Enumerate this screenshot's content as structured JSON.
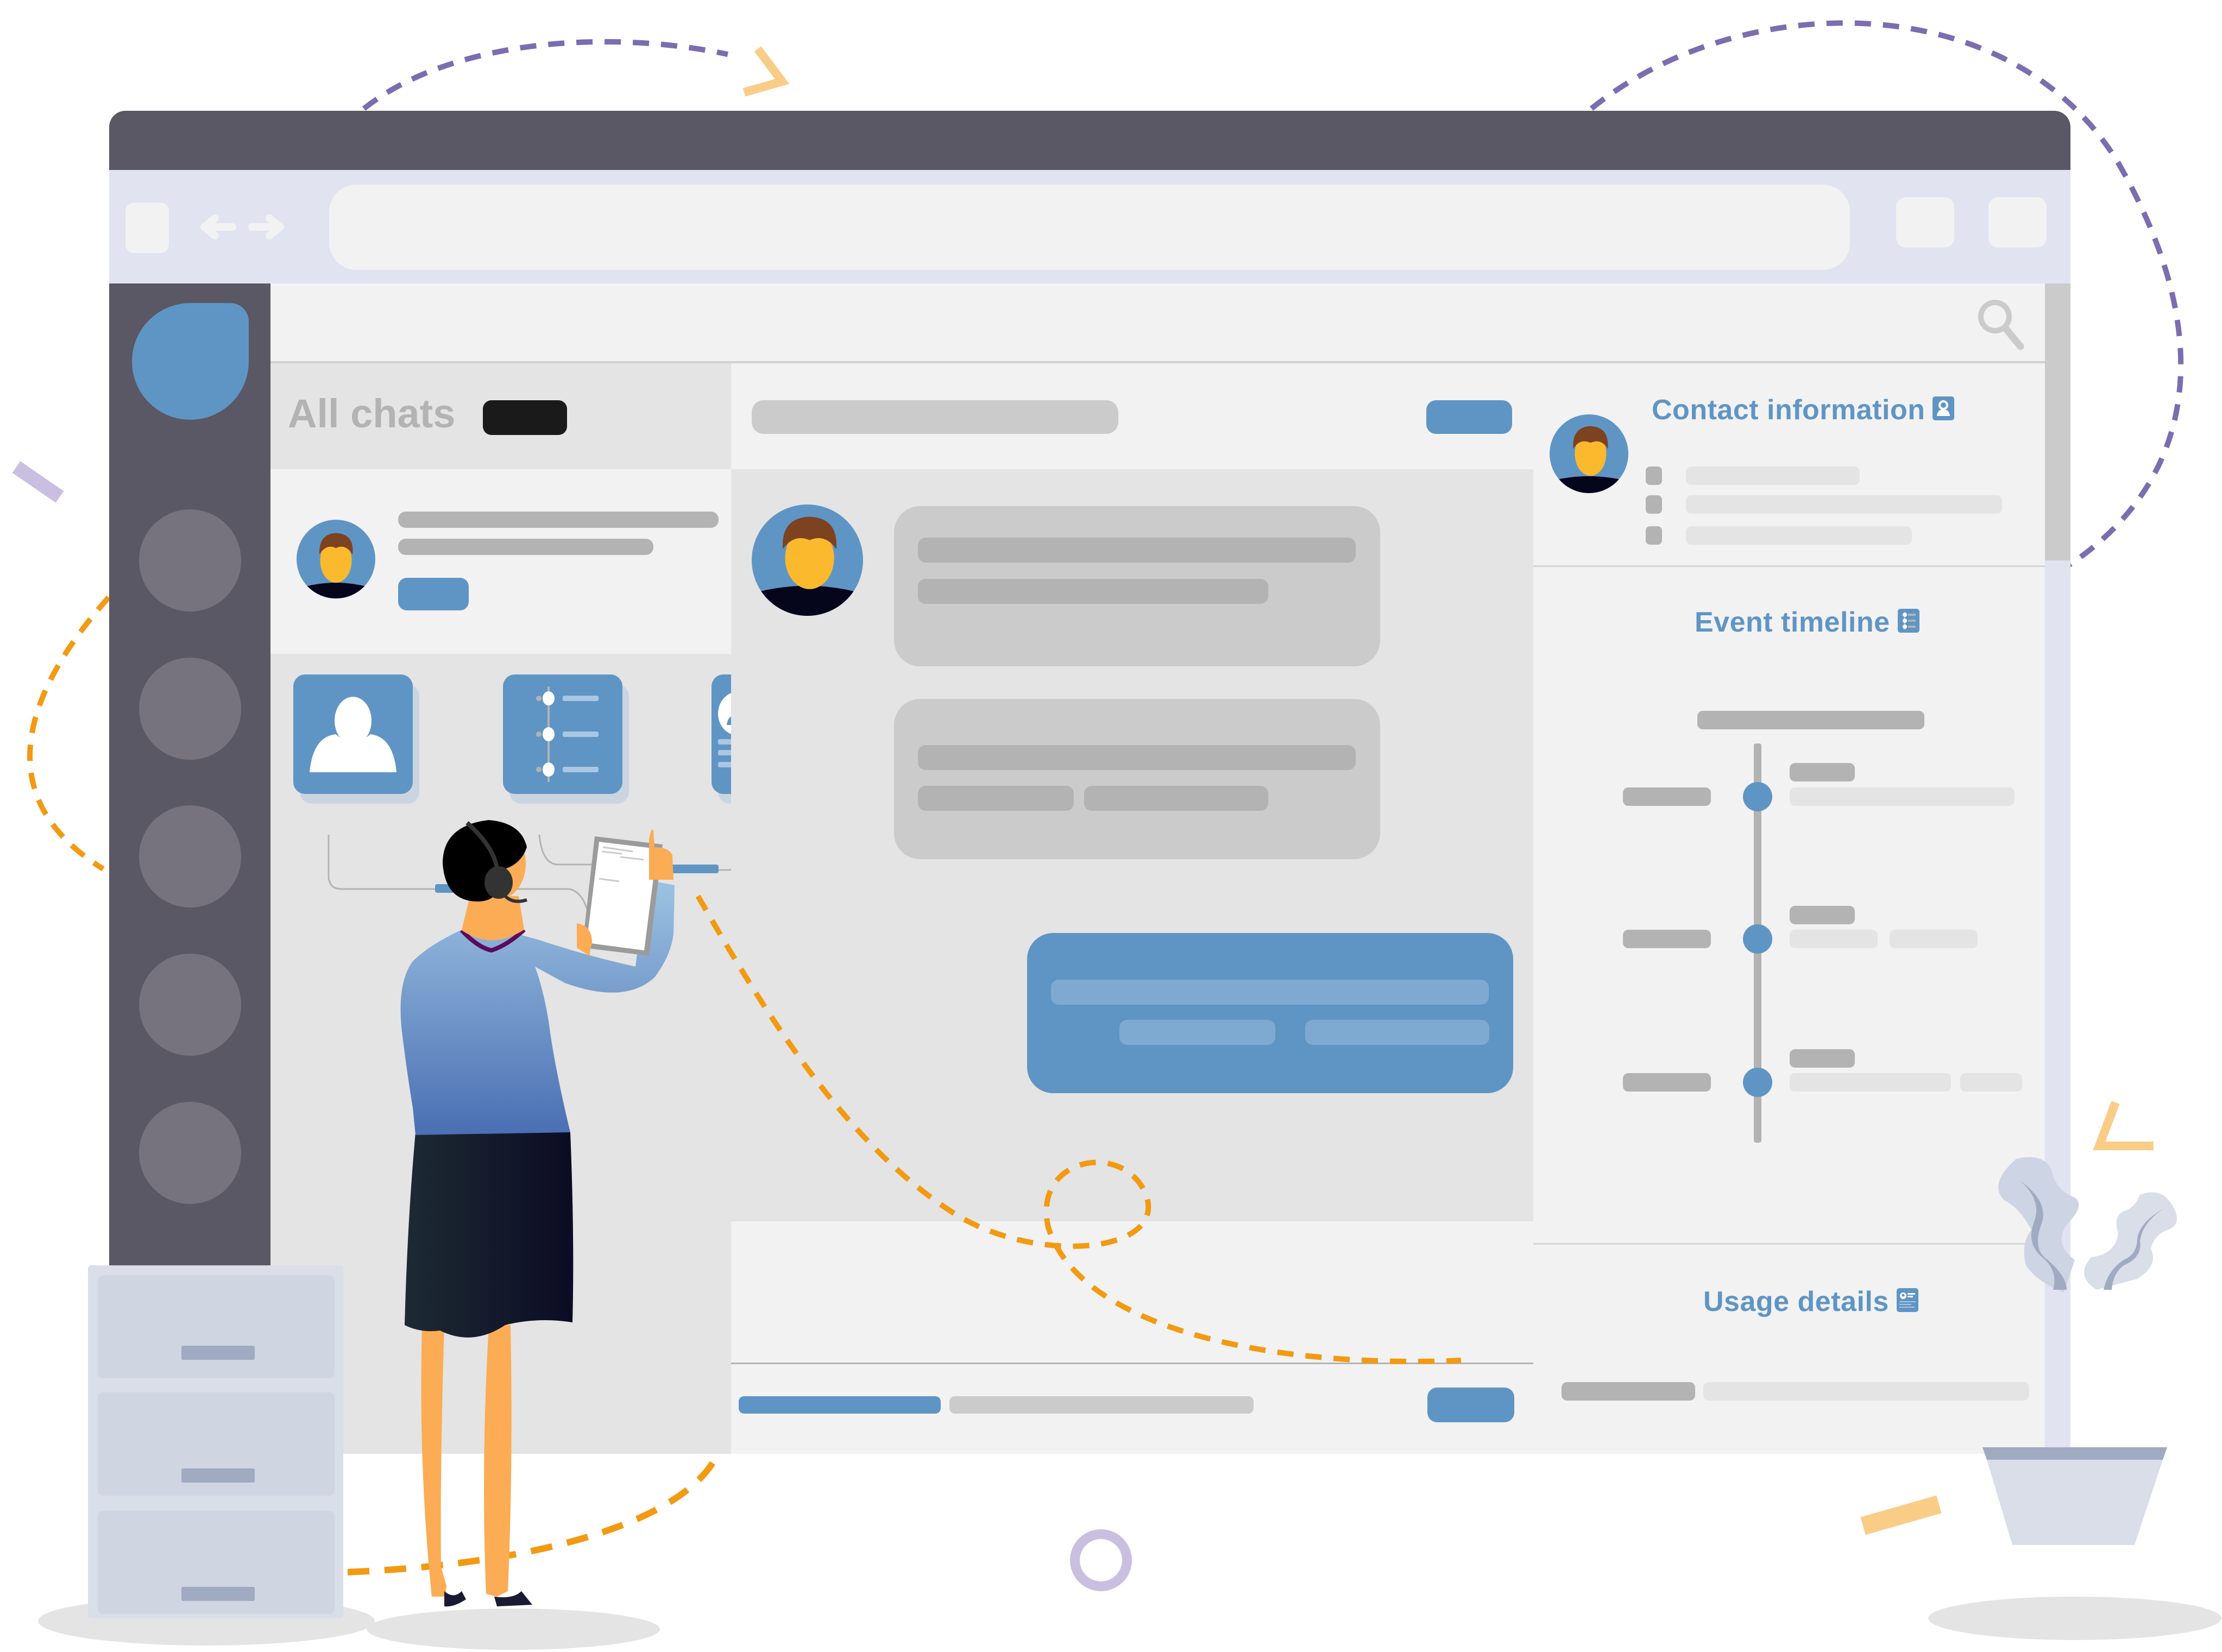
{
  "window": {
    "nav": {
      "back_icon": "arrow-left-icon",
      "forward_icon": "arrow-right-icon"
    },
    "address_bar": {
      "value": ""
    },
    "search_icon": "search-icon"
  },
  "sidebar": {
    "logo": "app-logo",
    "items": [
      {
        "icon": "nav-circle-1"
      },
      {
        "icon": "nav-circle-2"
      },
      {
        "icon": "nav-circle-3"
      },
      {
        "icon": "nav-circle-4"
      },
      {
        "icon": "nav-circle-5"
      }
    ]
  },
  "chat_list": {
    "title": "All chats",
    "badge": "",
    "items": [
      {
        "avatar": "user-avatar",
        "name": "",
        "preview": "",
        "tag": ""
      }
    ],
    "tool_cards": [
      {
        "icon": "contact-card-icon"
      },
      {
        "icon": "timeline-card-icon"
      },
      {
        "icon": "id-card-icon"
      }
    ]
  },
  "conversation": {
    "header_title": "",
    "header_action": "",
    "messages": [
      {
        "from": "customer",
        "lines": 2
      },
      {
        "from": "customer",
        "lines": 2
      },
      {
        "from": "agent",
        "lines": 2
      }
    ],
    "composer": {
      "value": "",
      "send_label": ""
    }
  },
  "details_panel": {
    "contact": {
      "title": "Contact information",
      "icon": "contact-icon",
      "fields": 3
    },
    "timeline": {
      "title": "Event timeline",
      "icon": "timeline-icon",
      "events": 3
    },
    "usage": {
      "title": "Usage details",
      "icon": "id-card-icon"
    }
  },
  "colors": {
    "accent": "#5f95c4",
    "titlebar": "#5a5864",
    "toolbar": "#e1e3f0",
    "sidebar": "#5a5864",
    "panel": "#f2f2f2",
    "panel_alt": "#e4e4e4",
    "dash_purple": "#7b6db0",
    "dash_orange": "#f29a12"
  }
}
